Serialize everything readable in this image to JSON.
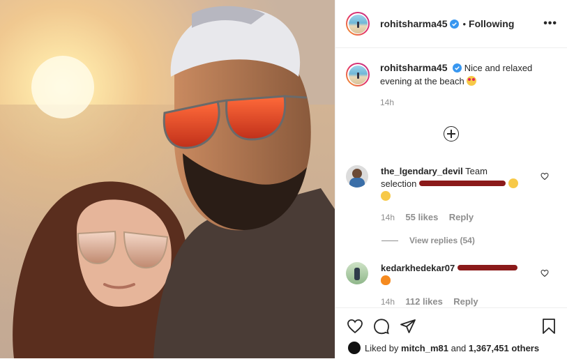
{
  "header": {
    "username": "rohitsharma45",
    "separator": "•",
    "follow_status": "Following",
    "more": "•••"
  },
  "caption": {
    "username": "rohitsharma45",
    "text": "Nice and relaxed evening at the beach",
    "time": "14h"
  },
  "comments": [
    {
      "username": "the_lgendary_devil",
      "text_start": "Team",
      "text_line2": "selection",
      "time": "14h",
      "likes": "55 likes",
      "reply": "Reply"
    },
    {
      "username": "kedarkhedekar07",
      "time": "14h",
      "likes": "112 likes",
      "reply": "Reply"
    }
  ],
  "view_replies": "View replies (54)",
  "likes": {
    "prefix": "Liked by",
    "user": "mitch_m81",
    "mid": "and",
    "count": "1,367,451 others"
  },
  "colors": {
    "verified": "#3897f0",
    "muted": "#8e8e8e",
    "text": "#262626",
    "redaction": "#8b1a1a"
  }
}
